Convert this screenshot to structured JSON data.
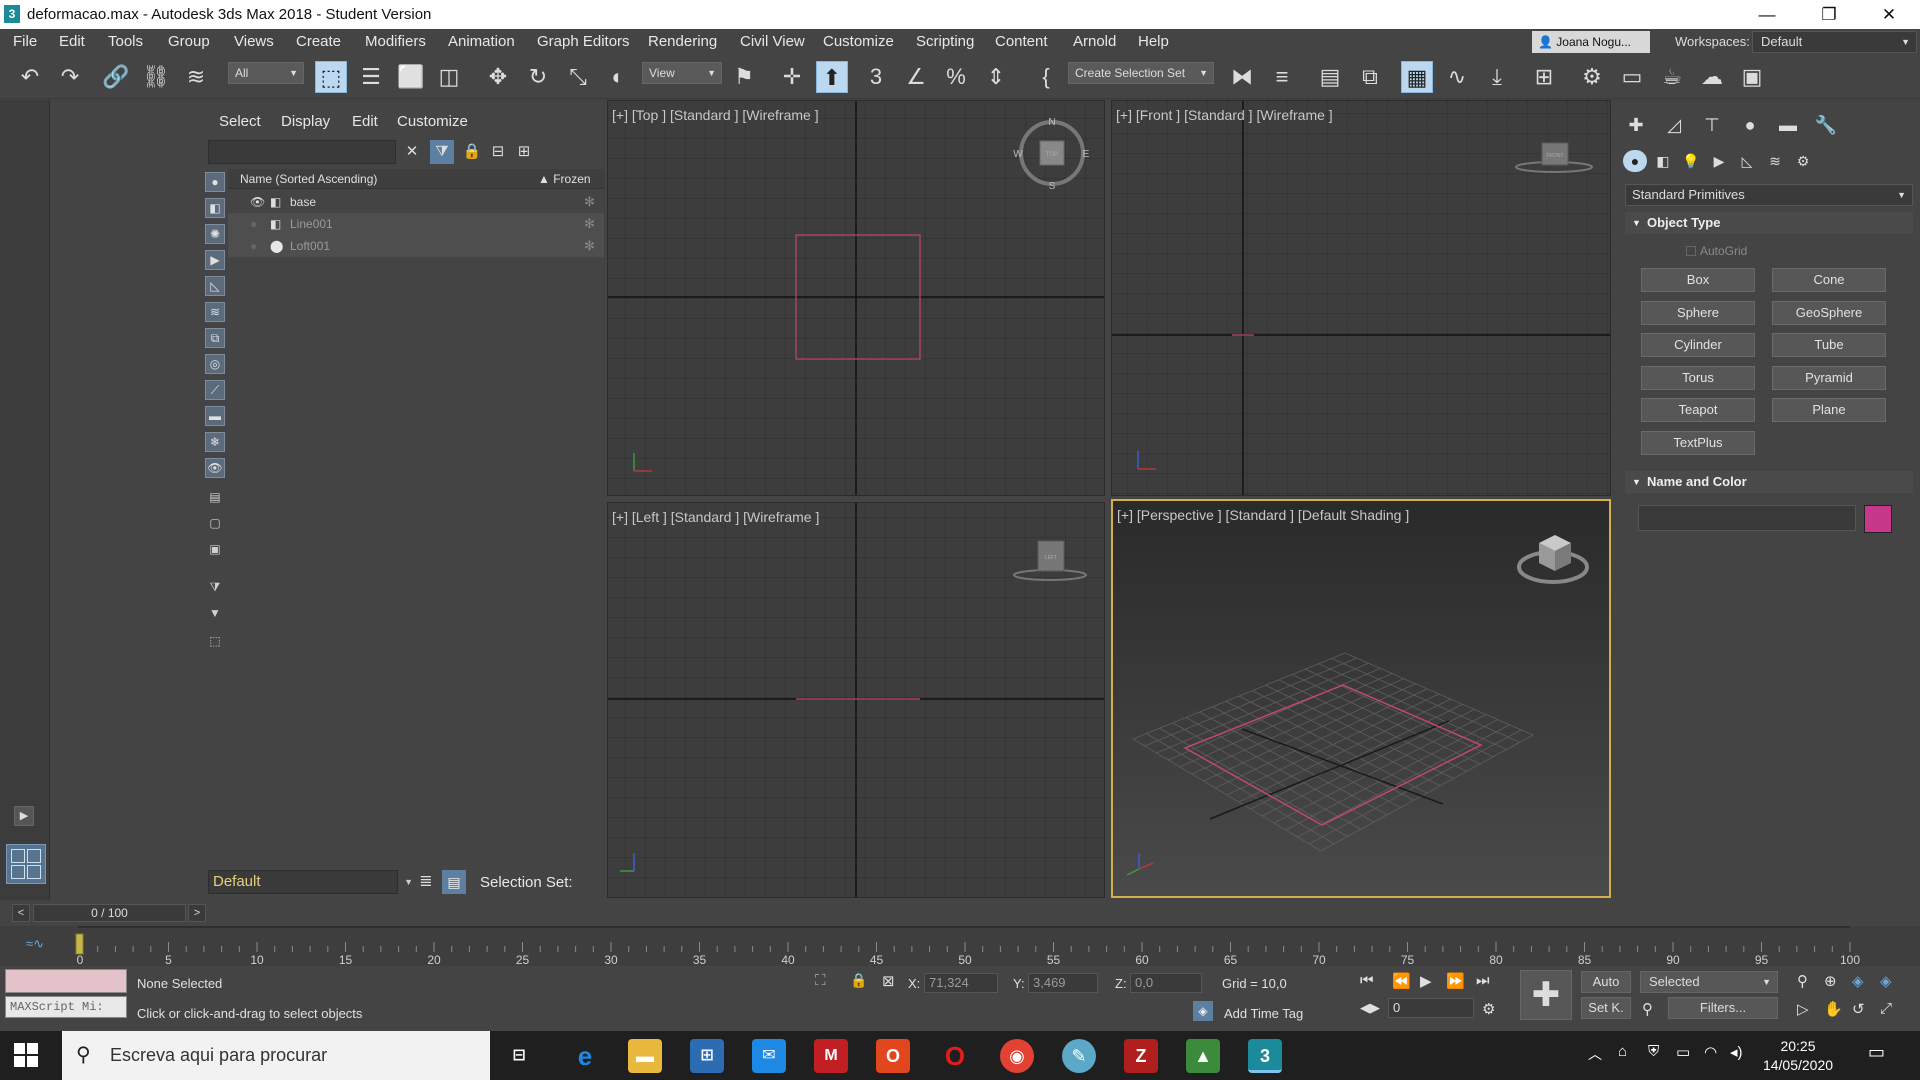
{
  "window": {
    "title": "deformacao.max - Autodesk 3ds Max 2018 - Student Version",
    "app_icon": "3",
    "minimize": "—",
    "restore": "❐",
    "close": "✕"
  },
  "menu": {
    "items": [
      "File",
      "Edit",
      "Tools",
      "Group",
      "Views",
      "Create",
      "Modifiers",
      "Animation",
      "Graph Editors",
      "Rendering",
      "Civil View",
      "Customize",
      "Scripting",
      "Content",
      "Arnold",
      "Help"
    ],
    "user": "Joana Nogu...",
    "workspaces_label": "Workspaces:",
    "workspace_value": "Default"
  },
  "toolbar": {
    "filter_value": "All",
    "ref_coord_value": "View",
    "selection_set_placeholder": "Create Selection Set"
  },
  "explorer": {
    "menus": [
      "Select",
      "Display",
      "Edit",
      "Customize"
    ],
    "header_name": "Name (Sorted Ascending)",
    "header_frozen": "▲ Frozen",
    "rows": [
      {
        "name": "base",
        "selected": false,
        "dim": false
      },
      {
        "name": "Line001",
        "selected": true,
        "dim": true
      },
      {
        "name": "Loft001",
        "selected": true,
        "dim": true
      }
    ],
    "layer": "Default",
    "selection_set_label": "Selection Set:"
  },
  "viewports": {
    "top_label": "[+] [Top ] [Standard ] [Wireframe ]",
    "front_label": "[+] [Front ] [Standard ] [Wireframe ]",
    "left_label": "[+] [Left ] [Standard ] [Wireframe ]",
    "persp_label": "[+] [Perspective ] [Standard ] [Default Shading ]",
    "compass": {
      "n": "N",
      "s": "S",
      "e": "E",
      "w": "W",
      "cube_top": "TOP"
    },
    "cube_front": "FRONT",
    "cube_left": "LEFT"
  },
  "command_panel": {
    "category": "Standard Primitives",
    "object_type_title": "Object Type",
    "autogrid": "AutoGrid",
    "primitives": [
      "Box",
      "Cone",
      "Sphere",
      "GeoSphere",
      "Cylinder",
      "Tube",
      "Torus",
      "Pyramid",
      "Teapot",
      "Plane",
      "TextPlus"
    ],
    "name_color_title": "Name and Color",
    "swatch_color": "#c8388a"
  },
  "timeline": {
    "slider": "0 / 100",
    "ticks": [
      "0",
      "5",
      "10",
      "15",
      "20",
      "25",
      "30",
      "35",
      "40",
      "45",
      "50",
      "55",
      "60",
      "65",
      "70",
      "75",
      "80",
      "85",
      "90",
      "95",
      "100"
    ]
  },
  "status": {
    "maxscript": "MAXScript Mi:",
    "selected_text": "None Selected",
    "prompt": "Click or click-and-drag to select objects",
    "x_label": "X:",
    "x_value": "71,324",
    "y_label": "Y:",
    "y_value": "3,469",
    "z_label": "Z:",
    "z_value": "0,0",
    "grid": "Grid = 10,0",
    "add_time_tag": "Add Time Tag",
    "auto": "Auto",
    "set_key": "Set K.",
    "selected_dropdown": "Selected",
    "filters": "Filters...",
    "frame_value": "0"
  },
  "taskbar": {
    "search_placeholder": "Escreva aqui para procurar",
    "time": "20:25",
    "date": "14/05/2020"
  }
}
